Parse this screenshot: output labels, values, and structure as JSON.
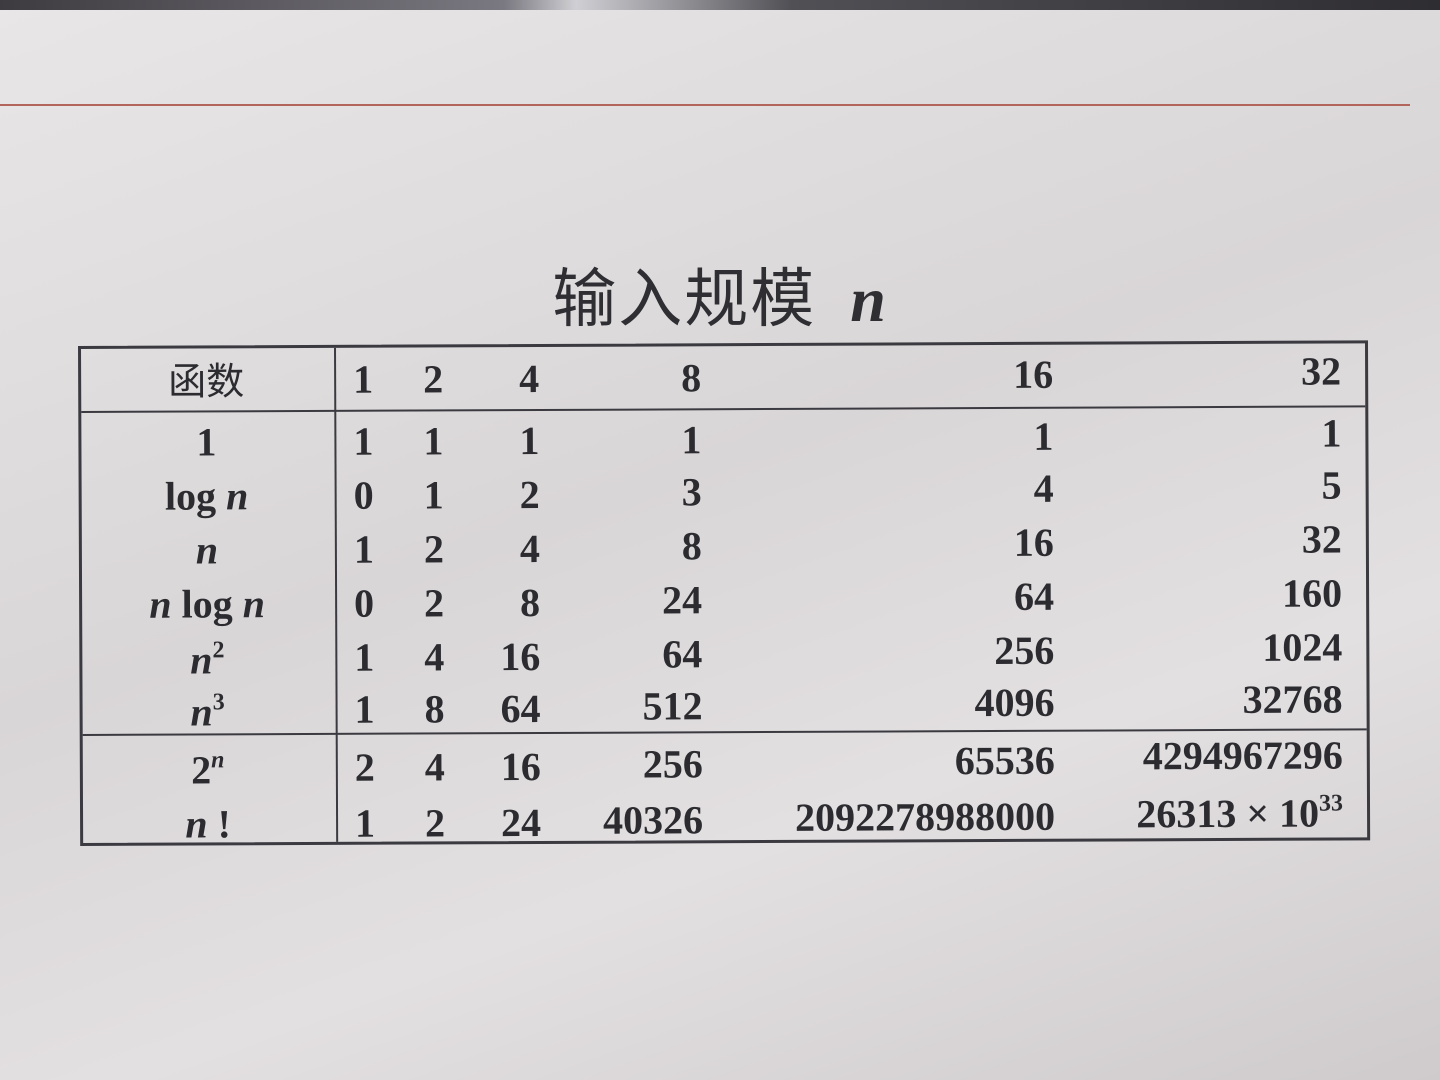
{
  "slide": {
    "title_text": "输入规模",
    "title_var": "n"
  },
  "table": {
    "header": {
      "function_label": "函数",
      "sizes": [
        "1",
        "2",
        "4",
        "8",
        "16",
        "32"
      ]
    },
    "rows": [
      {
        "fn_plain": "1",
        "values": [
          "1",
          "1",
          "1",
          "1",
          "1",
          "1"
        ]
      },
      {
        "fn_plain": "log ",
        "fn_var": "n",
        "values": [
          "0",
          "1",
          "2",
          "3",
          "4",
          "5"
        ]
      },
      {
        "fn_var": "n",
        "values": [
          "1",
          "2",
          "4",
          "8",
          "16",
          "32"
        ]
      },
      {
        "fn_var_pre": "n",
        "fn_plain": " log ",
        "fn_var": "n",
        "values": [
          "0",
          "2",
          "8",
          "24",
          "64",
          "160"
        ]
      },
      {
        "fn_var": "n",
        "fn_sup": "2",
        "values": [
          "1",
          "4",
          "16",
          "64",
          "256",
          "1024"
        ]
      },
      {
        "fn_var": "n",
        "fn_sup": "3",
        "values": [
          "1",
          "8",
          "64",
          "512",
          "4096",
          "32768"
        ]
      },
      {
        "fn_plain": "2",
        "fn_sup_var": "n",
        "values": [
          "2",
          "4",
          "16",
          "256",
          "65536",
          "4294967296"
        ]
      },
      {
        "fn_var": "n",
        "fn_plain_post": " !",
        "values": [
          "1",
          "2",
          "24",
          "40326",
          "2092278988000",
          "26313 × 10"
        ],
        "last_sup": "33"
      }
    ]
  },
  "colors": {
    "rule": "#b3645b",
    "text": "#2b2b30",
    "background": "#dfdcdc"
  }
}
